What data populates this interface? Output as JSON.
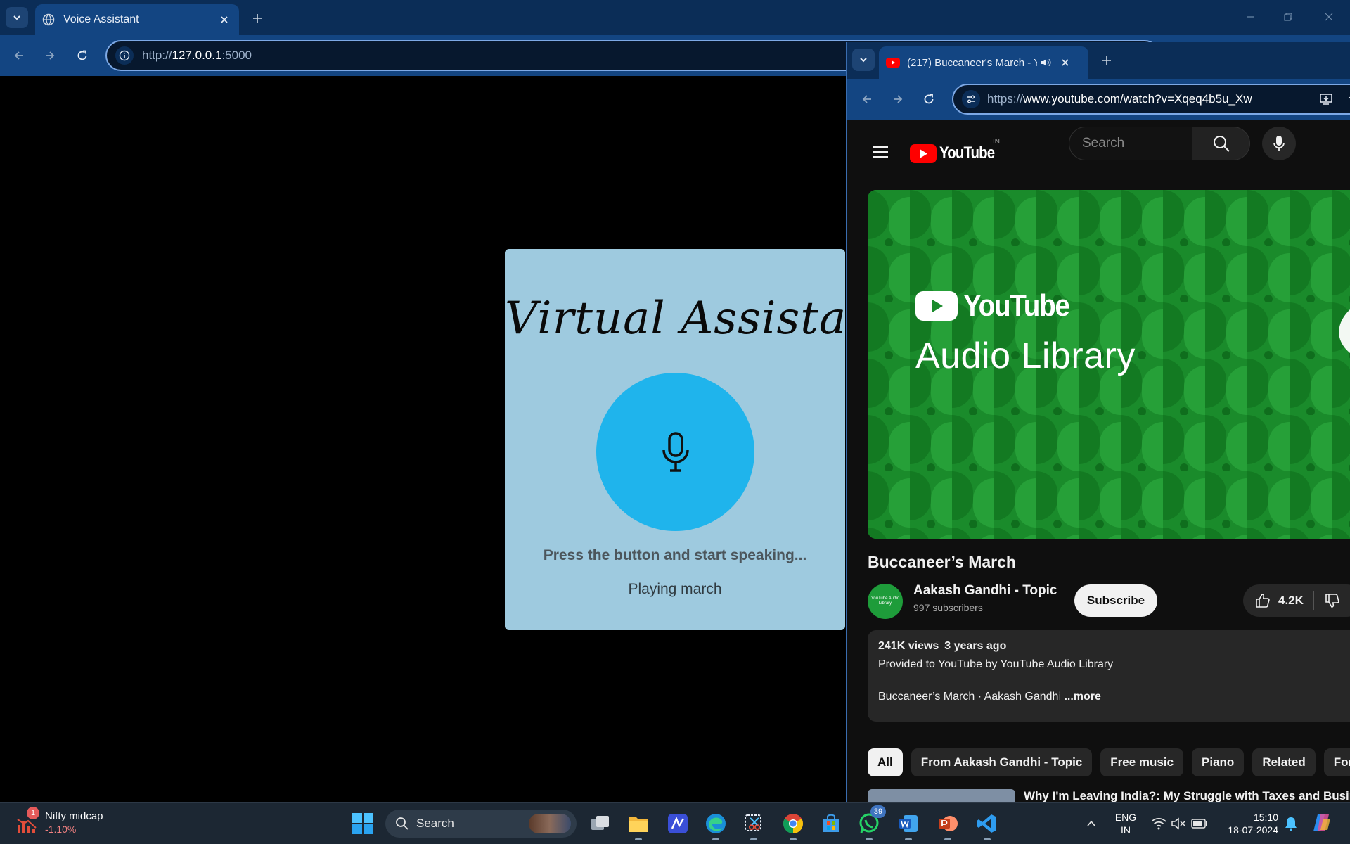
{
  "main_browser": {
    "tab": {
      "title": "Voice Assistant"
    },
    "address": {
      "scheme": "http://",
      "host": "127.0.0.1",
      "port": ":5000"
    }
  },
  "voice_assistant": {
    "title": "Virtual Assistant",
    "prompt": "Press the button and start speaking...",
    "status": "Playing march",
    "colors": {
      "card": "#9ecadf",
      "mic_button": "#1fb4ec"
    }
  },
  "youtube_browser": {
    "tab": {
      "title": "(217) Buccaneer's March - Y"
    },
    "address": {
      "scheme": "https://",
      "host": "www.youtube.com",
      "path": "/watch?v=Xqeq4b5u_Xw"
    }
  },
  "youtube": {
    "logo_text": "YouTube",
    "region": "IN",
    "search_placeholder": "Search",
    "player": {
      "brand": "YouTube",
      "subtitle": "Audio Library"
    },
    "video_title": "Buccaneer’s March",
    "channel": {
      "avatar_text": "YouTube Audio Library",
      "name": "Aakash Gandhi - Topic",
      "subscribers": "997 subscribers"
    },
    "subscribe_label": "Subscribe",
    "likes": "4.2K",
    "description": {
      "views": "241K views",
      "age": "3 years ago",
      "provided_by": "Provided to YouTube by YouTube Audio Library",
      "track_line": "Buccaneer’s March · Aakash Gandh",
      "track_line_fade": "i",
      "more": " ...more"
    },
    "chips": [
      "All",
      "From Aakash Gandhi - Topic",
      "Free music",
      "Piano",
      "Related",
      "For yo"
    ],
    "recommendation_title": "Why I'm Leaving India?: My Struggle with Taxes and Business"
  },
  "taskbar": {
    "widget": {
      "name": "Nifty midcap",
      "value": "-1.10%",
      "badge": "1"
    },
    "search_label": "Search",
    "whatsapp_badge": "39",
    "lang_primary": "ENG",
    "lang_secondary": "IN",
    "time": "15:10",
    "date": "18-07-2024"
  }
}
